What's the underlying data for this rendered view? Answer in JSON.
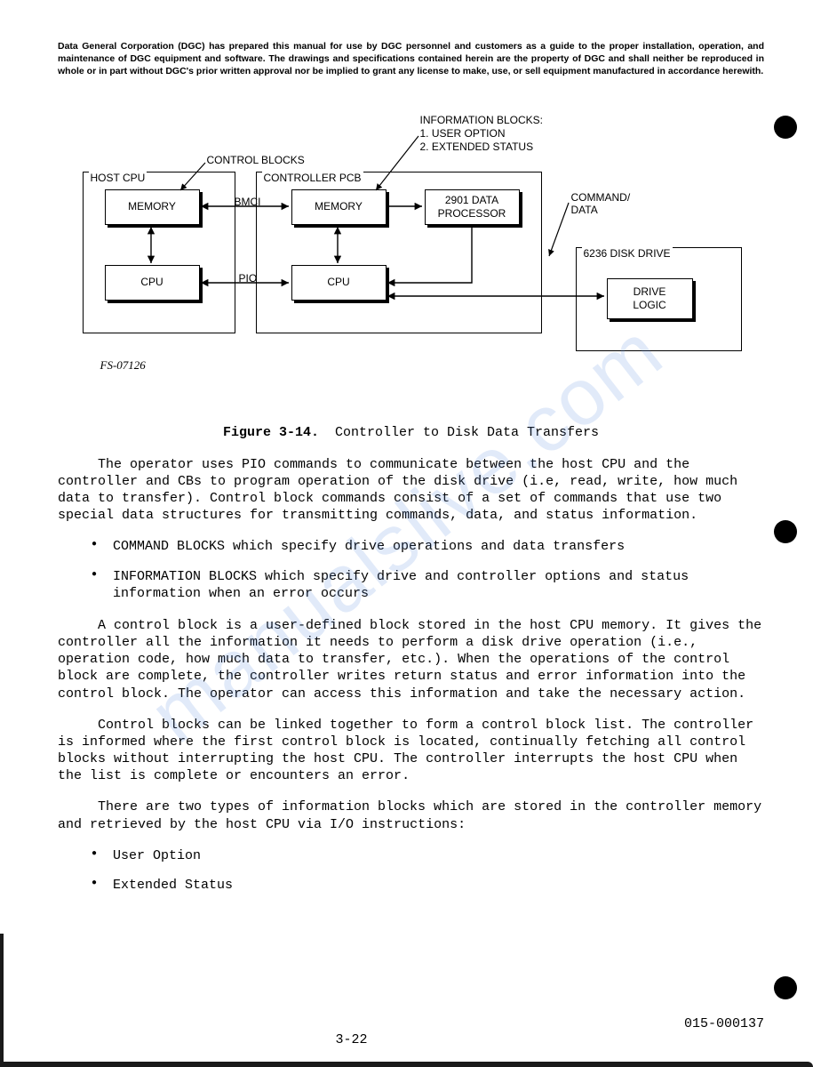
{
  "disclaimer": "Data General Corporation (DGC) has prepared this manual for use by DGC personnel and customers as a guide to the proper installation, operation, and maintenance of DGC equipment and software. The drawings and specifications contained herein are the property of DGC and shall neither be reproduced in whole or in part without DGC's prior written approval nor be implied to grant any license to make, use, or sell equipment manufactured in accordance herewith.",
  "diagram": {
    "info_blocks_heading": "INFORMATION BLOCKS:",
    "info_blocks_1": "1. USER OPTION",
    "info_blocks_2": "2. EXTENDED STATUS",
    "control_blocks": "CONTROL BLOCKS",
    "host_cpu": "HOST CPU",
    "controller_pcb": "CONTROLLER PCB",
    "memory1": "MEMORY",
    "memory2": "MEMORY",
    "processor": "2901 DATA\nPROCESSOR",
    "cpu1": "CPU",
    "cpu2": "CPU",
    "bmci": "BMCI",
    "pio": "PIO",
    "command_data": "COMMAND/\nDATA",
    "disk_drive": "6236 DISK DRIVE",
    "drive_logic": "DRIVE\nLOGIC",
    "fs_code": "FS-07126"
  },
  "figure": {
    "label": "Figure 3-14.",
    "title": "Controller to Disk Data Transfers"
  },
  "para1": "The operator uses PIO commands to communicate between the host CPU and the controller and CBs to program operation of the disk drive (i.e, read, write, how much data to transfer).  Control block commands consist of a set of commands that use two special data structures for transmitting commands, data, and status information.",
  "bullets1": {
    "b1": "COMMAND BLOCKS which specify drive operations and data transfers",
    "b2": "INFORMATION BLOCKS which specify drive and controller options and status information when an error occurs"
  },
  "para2": "A control block is a user-defined block stored in the host CPU memory.  It gives the controller all the information it needs to perform a disk drive operation (i.e., operation code, how much data to transfer, etc.).  When the operations of the control block are complete, the controller writes return status and error information into the control block.  The operator can access this information and take the necessary action.",
  "para3": "Control blocks can be linked together to form a control block list. The controller is informed where the first control block is located, continually fetching all control blocks without interrupting the host CPU.  The controller interrupts the host CPU when the list is complete or encounters an error.",
  "para4": "There are two types of information blocks which are stored in the controller memory and retrieved by the host CPU via I/O instructions:",
  "bullets2": {
    "b1": "User Option",
    "b2": "Extended Status"
  },
  "page_num": "3-22",
  "doc_num": "015-000137",
  "watermark": "manualslive.com"
}
